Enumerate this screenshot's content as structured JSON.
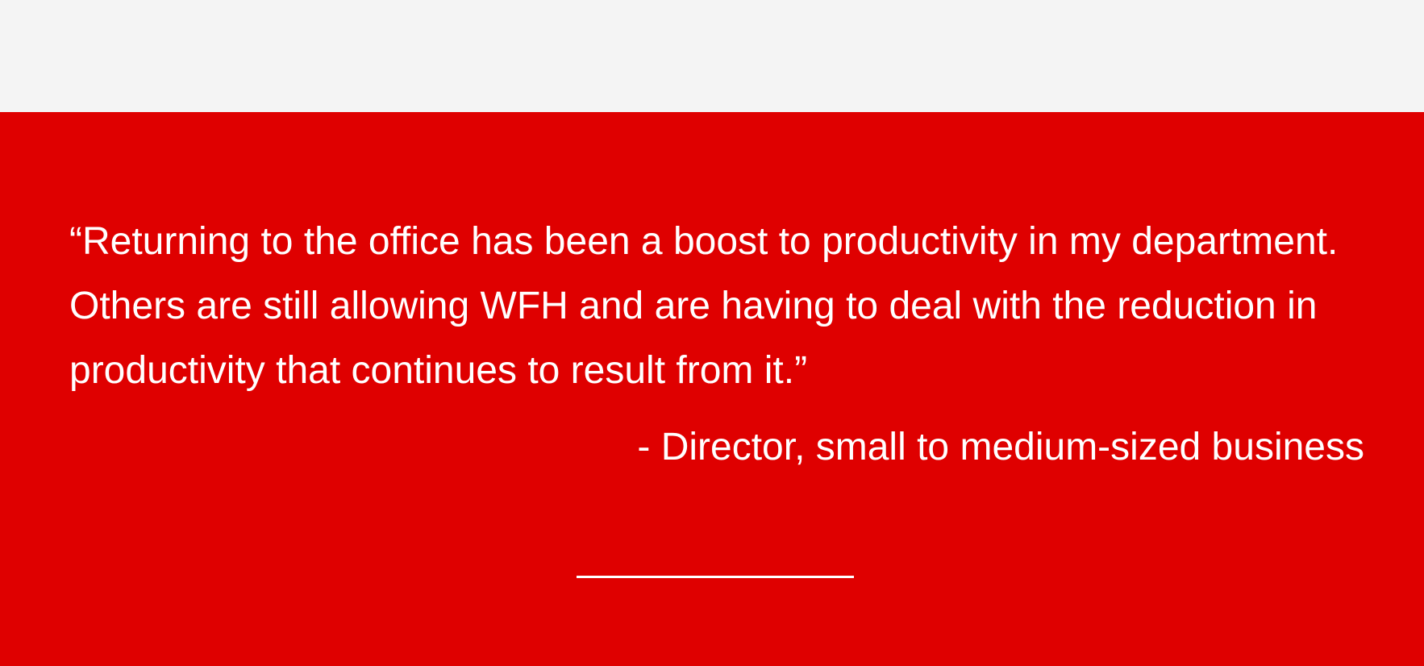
{
  "quote": {
    "text": "“Returning to the office has been a boost to productivity in my department. Others are still allowing WFH and are having to deal with the reduction in productivity that continues to result from it.”",
    "attribution": "- Director, small to medium-sized business"
  },
  "colors": {
    "background_top": "#f4f4f4",
    "quote_background": "#df0000",
    "quote_text": "#ffffff",
    "divider": "#ffffff"
  }
}
